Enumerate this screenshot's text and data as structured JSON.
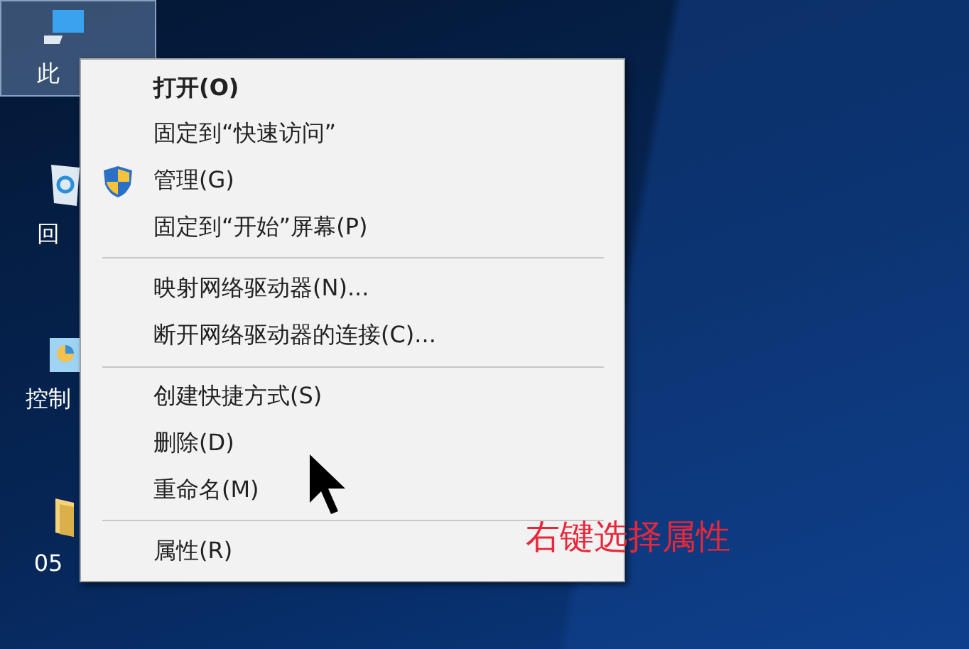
{
  "desktop_icons": [
    {
      "kind": "computer",
      "label": "此",
      "selected": true
    },
    {
      "kind": "recycle",
      "label": "回",
      "selected": false
    },
    {
      "kind": "control",
      "label": "控制",
      "selected": false
    },
    {
      "kind": "folder",
      "label": "05",
      "selected": false
    }
  ],
  "context_menu": {
    "items": [
      {
        "kind": "default",
        "label": "打开(O)"
      },
      {
        "kind": "item",
        "label": "固定到“快速访问”"
      },
      {
        "kind": "shield",
        "label": "管理(G)"
      },
      {
        "kind": "item",
        "label": "固定到“开始”屏幕(P)"
      },
      {
        "kind": "separator"
      },
      {
        "kind": "item",
        "label": "映射网络驱动器(N)..."
      },
      {
        "kind": "item",
        "label": "断开网络驱动器的连接(C)..."
      },
      {
        "kind": "separator"
      },
      {
        "kind": "item",
        "label": "创建快捷方式(S)"
      },
      {
        "kind": "item",
        "label": "删除(D)"
      },
      {
        "kind": "item",
        "label": "重命名(M)"
      },
      {
        "kind": "separator"
      },
      {
        "kind": "item",
        "label": "属性(R)"
      }
    ]
  },
  "annotation": "右键选择属性"
}
